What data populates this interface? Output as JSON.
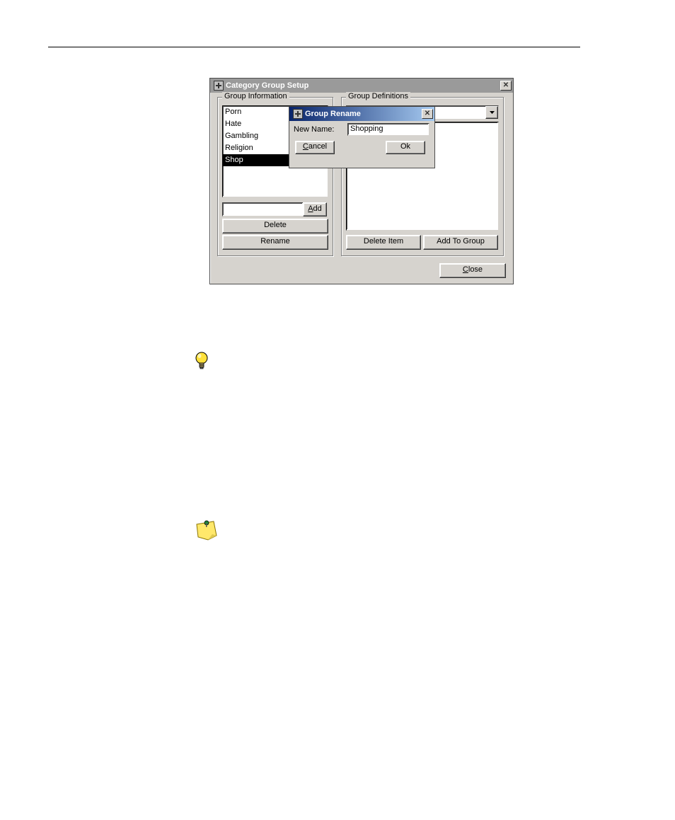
{
  "main_window": {
    "title": "Category Group Setup",
    "group_info": {
      "legend": "Group Information",
      "items": [
        "Porn",
        "Hate",
        "Gambling",
        "Religion",
        "Shop"
      ],
      "selected_index": 4,
      "new_group_value": "",
      "add_label": "Add",
      "delete_label": "Delete",
      "rename_label": "Rename"
    },
    "group_defs": {
      "legend": "Group Definitions",
      "combo_value": "",
      "delete_item_label": "Delete Item",
      "add_to_group_label": "Add To Group"
    },
    "close_label": "Close"
  },
  "rename_dialog": {
    "title": "Group Rename",
    "label": "New Name:",
    "value": "Shopping",
    "cancel_label": "Cancel",
    "ok_label": "Ok"
  },
  "colors": {
    "dialog_bg": "#d6d3ce",
    "inactive_title": "#9a9a9a",
    "active_title_start": "#08246b",
    "active_title_end": "#a6caf0"
  }
}
